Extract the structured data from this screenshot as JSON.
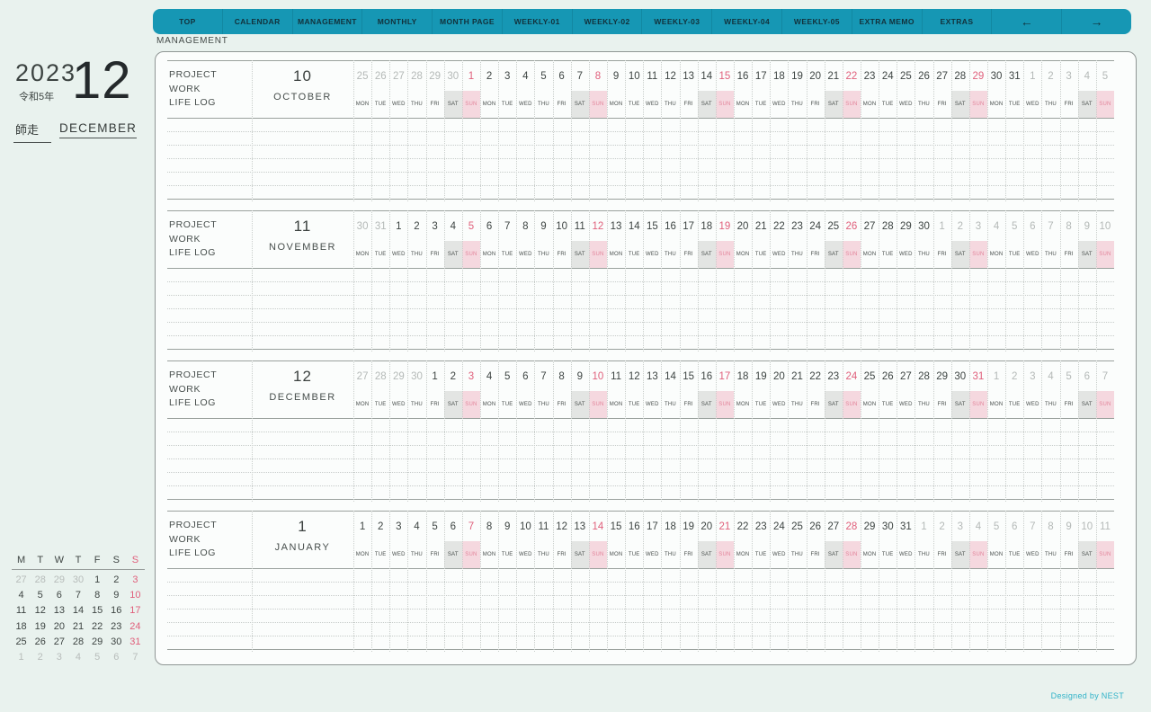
{
  "nav": {
    "breadcrumb": "MANAGEMENT",
    "tabs": [
      "TOP",
      "CALENDAR",
      "MANAGEMENT",
      "MONTHLY",
      "MONTH PAGE",
      "WEEKLY-01",
      "WEEKLY-02",
      "WEEKLY-03",
      "WEEKLY-04",
      "WEEKLY-05",
      "EXTRA MEMO",
      "EXTRAS"
    ],
    "arrow_left": "←",
    "arrow_right": "→"
  },
  "date_header": {
    "year": "2023",
    "era": "令和5年",
    "month_number": "12",
    "month_jp": "師走",
    "month_name": "DECEMBER"
  },
  "weekday_labels": [
    "MON",
    "TUE",
    "WED",
    "THU",
    "FRI",
    "SAT",
    "SUN"
  ],
  "row_labels": [
    "PROJECT",
    "WORK",
    "LIFE LOG"
  ],
  "sections": [
    {
      "month_num": "10",
      "month_name": "OCTOBER",
      "days": [
        [
          25,
          1
        ],
        [
          26,
          1
        ],
        [
          27,
          1
        ],
        [
          28,
          1
        ],
        [
          29,
          1
        ],
        [
          30,
          1
        ],
        [
          1,
          0
        ],
        [
          2,
          0
        ],
        [
          3,
          0
        ],
        [
          4,
          0
        ],
        [
          5,
          0
        ],
        [
          6,
          0
        ],
        [
          7,
          0
        ],
        [
          8,
          0
        ],
        [
          9,
          0
        ],
        [
          10,
          0
        ],
        [
          11,
          0
        ],
        [
          12,
          0
        ],
        [
          13,
          0
        ],
        [
          14,
          0
        ],
        [
          15,
          0
        ],
        [
          16,
          0
        ],
        [
          17,
          0
        ],
        [
          18,
          0
        ],
        [
          19,
          0
        ],
        [
          20,
          0
        ],
        [
          21,
          0
        ],
        [
          22,
          0
        ],
        [
          23,
          0
        ],
        [
          24,
          0
        ],
        [
          25,
          0
        ],
        [
          26,
          0
        ],
        [
          27,
          0
        ],
        [
          28,
          0
        ],
        [
          29,
          0
        ],
        [
          30,
          0
        ],
        [
          31,
          0
        ],
        [
          1,
          1
        ],
        [
          2,
          1
        ],
        [
          3,
          1
        ],
        [
          4,
          1
        ],
        [
          5,
          1
        ]
      ]
    },
    {
      "month_num": "11",
      "month_name": "NOVEMBER",
      "days": [
        [
          30,
          1
        ],
        [
          31,
          1
        ],
        [
          1,
          0
        ],
        [
          2,
          0
        ],
        [
          3,
          0
        ],
        [
          4,
          0
        ],
        [
          5,
          0
        ],
        [
          6,
          0
        ],
        [
          7,
          0
        ],
        [
          8,
          0
        ],
        [
          9,
          0
        ],
        [
          10,
          0
        ],
        [
          11,
          0
        ],
        [
          12,
          0
        ],
        [
          13,
          0
        ],
        [
          14,
          0
        ],
        [
          15,
          0
        ],
        [
          16,
          0
        ],
        [
          17,
          0
        ],
        [
          18,
          0
        ],
        [
          19,
          0
        ],
        [
          20,
          0
        ],
        [
          21,
          0
        ],
        [
          22,
          0
        ],
        [
          23,
          0
        ],
        [
          24,
          0
        ],
        [
          25,
          0
        ],
        [
          26,
          0
        ],
        [
          27,
          0
        ],
        [
          28,
          0
        ],
        [
          29,
          0
        ],
        [
          30,
          0
        ],
        [
          1,
          1
        ],
        [
          2,
          1
        ],
        [
          3,
          1
        ],
        [
          4,
          1
        ],
        [
          5,
          1
        ],
        [
          6,
          1
        ],
        [
          7,
          1
        ],
        [
          8,
          1
        ],
        [
          9,
          1
        ],
        [
          10,
          1
        ]
      ]
    },
    {
      "month_num": "12",
      "month_name": "DECEMBER",
      "days": [
        [
          27,
          1
        ],
        [
          28,
          1
        ],
        [
          29,
          1
        ],
        [
          30,
          1
        ],
        [
          1,
          0
        ],
        [
          2,
          0
        ],
        [
          3,
          0
        ],
        [
          4,
          0
        ],
        [
          5,
          0
        ],
        [
          6,
          0
        ],
        [
          7,
          0
        ],
        [
          8,
          0
        ],
        [
          9,
          0
        ],
        [
          10,
          0
        ],
        [
          11,
          0
        ],
        [
          12,
          0
        ],
        [
          13,
          0
        ],
        [
          14,
          0
        ],
        [
          15,
          0
        ],
        [
          16,
          0
        ],
        [
          17,
          0
        ],
        [
          18,
          0
        ],
        [
          19,
          0
        ],
        [
          20,
          0
        ],
        [
          21,
          0
        ],
        [
          22,
          0
        ],
        [
          23,
          0
        ],
        [
          24,
          0
        ],
        [
          25,
          0
        ],
        [
          26,
          0
        ],
        [
          27,
          0
        ],
        [
          28,
          0
        ],
        [
          29,
          0
        ],
        [
          30,
          0
        ],
        [
          31,
          0
        ],
        [
          1,
          1
        ],
        [
          2,
          1
        ],
        [
          3,
          1
        ],
        [
          4,
          1
        ],
        [
          5,
          1
        ],
        [
          6,
          1
        ],
        [
          7,
          1
        ]
      ]
    },
    {
      "month_num": "1",
      "month_name": "JANUARY",
      "days": [
        [
          1,
          0
        ],
        [
          2,
          0
        ],
        [
          3,
          0
        ],
        [
          4,
          0
        ],
        [
          5,
          0
        ],
        [
          6,
          0
        ],
        [
          7,
          0
        ],
        [
          8,
          0
        ],
        [
          9,
          0
        ],
        [
          10,
          0
        ],
        [
          11,
          0
        ],
        [
          12,
          0
        ],
        [
          13,
          0
        ],
        [
          14,
          0
        ],
        [
          15,
          0
        ],
        [
          16,
          0
        ],
        [
          17,
          0
        ],
        [
          18,
          0
        ],
        [
          19,
          0
        ],
        [
          20,
          0
        ],
        [
          21,
          0
        ],
        [
          22,
          0
        ],
        [
          23,
          0
        ],
        [
          24,
          0
        ],
        [
          25,
          0
        ],
        [
          26,
          0
        ],
        [
          27,
          0
        ],
        [
          28,
          0
        ],
        [
          29,
          0
        ],
        [
          30,
          0
        ],
        [
          31,
          0
        ],
        [
          1,
          1
        ],
        [
          2,
          1
        ],
        [
          3,
          1
        ],
        [
          4,
          1
        ],
        [
          5,
          1
        ],
        [
          6,
          1
        ],
        [
          7,
          1
        ],
        [
          8,
          1
        ],
        [
          9,
          1
        ],
        [
          10,
          1
        ],
        [
          11,
          1
        ]
      ]
    }
  ],
  "mini_calendar": {
    "headers": [
      "M",
      "T",
      "W",
      "T",
      "F",
      "S",
      "S"
    ],
    "rows": [
      [
        [
          27,
          1
        ],
        [
          28,
          1
        ],
        [
          29,
          1
        ],
        [
          30,
          1
        ],
        [
          1,
          0
        ],
        [
          2,
          0
        ],
        [
          3,
          0
        ]
      ],
      [
        [
          4,
          0
        ],
        [
          5,
          0
        ],
        [
          6,
          0
        ],
        [
          7,
          0
        ],
        [
          8,
          0
        ],
        [
          9,
          0
        ],
        [
          10,
          0
        ]
      ],
      [
        [
          11,
          0
        ],
        [
          12,
          0
        ],
        [
          13,
          0
        ],
        [
          14,
          0
        ],
        [
          15,
          0
        ],
        [
          16,
          0
        ],
        [
          17,
          0
        ]
      ],
      [
        [
          18,
          0
        ],
        [
          19,
          0
        ],
        [
          20,
          0
        ],
        [
          21,
          0
        ],
        [
          22,
          0
        ],
        [
          23,
          0
        ],
        [
          24,
          0
        ]
      ],
      [
        [
          25,
          0
        ],
        [
          26,
          0
        ],
        [
          27,
          0
        ],
        [
          28,
          0
        ],
        [
          29,
          0
        ],
        [
          30,
          0
        ],
        [
          31,
          0
        ]
      ],
      [
        [
          1,
          1
        ],
        [
          2,
          1
        ],
        [
          3,
          1
        ],
        [
          4,
          1
        ],
        [
          5,
          1
        ],
        [
          6,
          1
        ],
        [
          7,
          1
        ]
      ]
    ]
  },
  "footer": {
    "credit": "Designed by NEST"
  },
  "colors": {
    "accent_teal": "#1697b4",
    "sunday_pink": "#e0607c",
    "saturday_bg": "#e3e5e3",
    "sunday_bg": "#f5d8df",
    "outside_month_gray": "#b4b9b7"
  }
}
